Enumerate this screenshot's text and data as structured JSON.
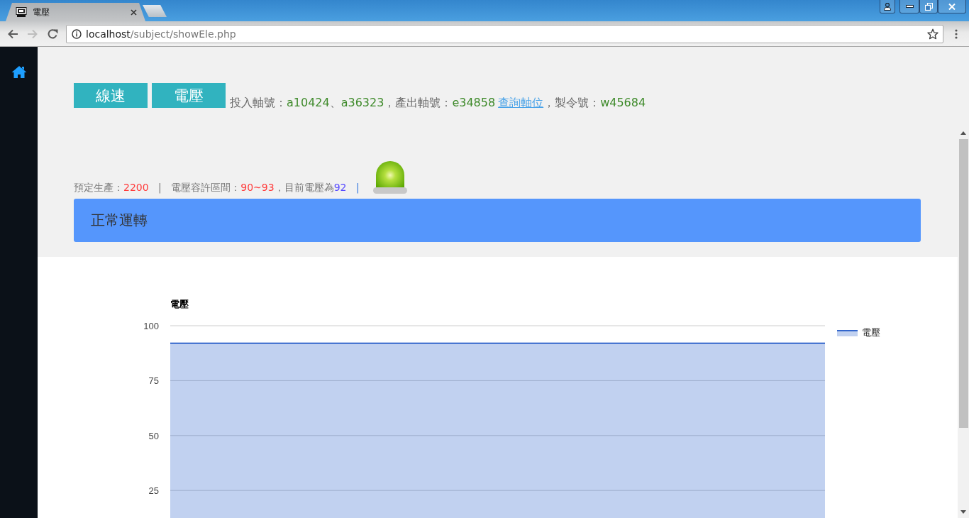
{
  "browser": {
    "tabs": [
      {
        "title": "電壓",
        "selected": true
      }
    ],
    "nav_buttons": [
      {
        "kind": "back",
        "disabled": false
      },
      {
        "kind": "forward",
        "disabled": true
      },
      {
        "kind": "reload",
        "disabled": false
      }
    ],
    "address": {
      "host": "localhost",
      "path": "/subject/showEle.php"
    },
    "bookmarked": false
  },
  "sidebar": {
    "items": [
      {
        "kind": "home"
      }
    ]
  },
  "header": {
    "buttons": [
      {
        "label": "線速"
      },
      {
        "label": "電壓"
      }
    ],
    "info": [
      {
        "kind": "label",
        "text": "投入軸號："
      },
      {
        "kind": "value",
        "text": "a10424"
      },
      {
        "kind": "label",
        "text": "、"
      },
      {
        "kind": "value",
        "text": "a36323"
      },
      {
        "kind": "label",
        "text": "，產出軸號："
      },
      {
        "kind": "value",
        "text": "e34858"
      },
      {
        "kind": "link",
        "text": "查詢軸位"
      },
      {
        "kind": "label",
        "text": "，製令號："
      },
      {
        "kind": "value",
        "text": "w45684"
      }
    ],
    "status": [
      {
        "kind": "label",
        "text": "預定生產："
      },
      {
        "kind": "limit",
        "text": "2200"
      },
      {
        "kind": "divider",
        "text": "|"
      },
      {
        "kind": "label",
        "text": "電壓容許區間："
      },
      {
        "kind": "limit",
        "text": "90~93"
      },
      {
        "kind": "label",
        "text": "，目前電壓為"
      },
      {
        "kind": "current",
        "text": "92"
      },
      {
        "kind": "accent-divider",
        "text": "|"
      }
    ],
    "lamp": {
      "on": true
    },
    "banner": {
      "text": "正常運轉"
    }
  },
  "chart": {
    "chart_data": {
      "type": "area",
      "title": "電壓",
      "ylim": [
        0,
        100
      ],
      "yticks": [
        25,
        50,
        75,
        100
      ],
      "grid": true,
      "series": [
        {
          "name": "電壓",
          "color": "#3366cc",
          "values": [
            92,
            92,
            92,
            92,
            92,
            92
          ]
        }
      ]
    }
  }
}
